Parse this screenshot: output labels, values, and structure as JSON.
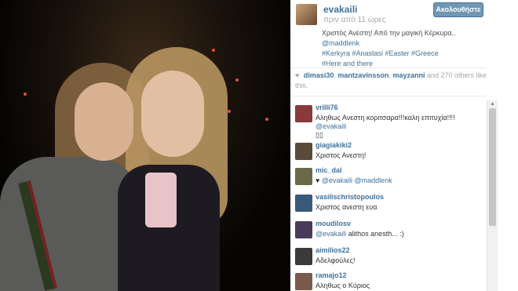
{
  "post": {
    "username": "evakaili",
    "time_ago": "πριν από 11 ώρες",
    "follow_label": "Ακολουθήστε",
    "caption_text": "Χριστός Ανέστη! Από την μαγική Κέρκυρα..",
    "caption_mention": "@maddlenk",
    "caption_tags_line1": "#Kerkyra #Anastasi #Easter #Greece",
    "caption_tags_line2": "#Here and there"
  },
  "likes": {
    "names": [
      "dimasi30",
      "mantzavinsson",
      "mayzanni"
    ],
    "rest": "and 270 others like this."
  },
  "comments": [
    {
      "user": "vrilli76",
      "text": "Αληθως Ανεστη κοριτσαρα!!!καλη επιτυχία!!!! ",
      "mention": "@evakaili",
      "extra": "▯▯",
      "avatar_color": "#8a3a3a"
    },
    {
      "user": "giagiakiki2",
      "text": "Χριστος Ανεστη!",
      "mention": "",
      "extra": "",
      "avatar_color": "#5a4a3a"
    },
    {
      "user": "mic_dal",
      "text": "♥ ",
      "mention": "@evakaili @maddlenk",
      "extra": "",
      "avatar_color": "#6a6a4a"
    },
    {
      "user": "vasilischristopoulos",
      "text": "Χριστος ανεστη ευα",
      "mention": "",
      "extra": "",
      "avatar_color": "#3a5a7a"
    },
    {
      "user": "moudilosv",
      "text": " alithos anesth... :)",
      "mention": "@evakaili",
      "extra": "",
      "avatar_color": "#4a3a5a"
    },
    {
      "user": "aimilios22",
      "text": "Αδελφούλες!",
      "mention": "",
      "extra": "",
      "avatar_color": "#3a3a3a"
    },
    {
      "user": "ramajo12",
      "text": "Αληθως ο Κύριος",
      "mention": "",
      "extra": "",
      "avatar_color": "#7a5a4a"
    }
  ]
}
